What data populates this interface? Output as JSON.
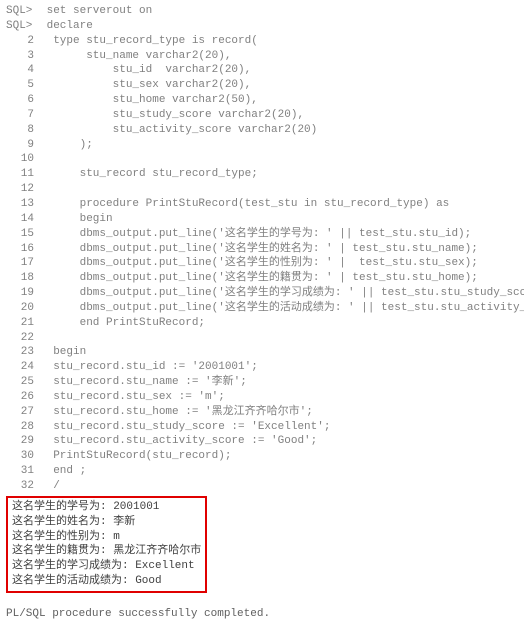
{
  "prompts": {
    "sql": "SQL>",
    "n2": "  2",
    "n3": "  3",
    "n4": "  4",
    "n5": "  5",
    "n6": "  6",
    "n7": "  7",
    "n8": "  8",
    "n9": "  9",
    "n10": " 10",
    "n11": " 11",
    "n12": " 12",
    "n13": " 13",
    "n14": " 14",
    "n15": " 15",
    "n16": " 16",
    "n17": " 17",
    "n18": " 18",
    "n19": " 19",
    "n20": " 20",
    "n21": " 21",
    "n22": " 22",
    "n23": " 23",
    "n24": " 24",
    "n25": " 25",
    "n26": " 26",
    "n27": " 27",
    "n28": " 28",
    "n29": " 29",
    "n30": " 30",
    "n31": " 31",
    "n32": " 32"
  },
  "code": {
    "l1": " set serverout on",
    "l2": " declare",
    "l3": "  type stu_record_type is record(",
    "l4": "       stu_name varchar2(20),",
    "l5": "           stu_id  varchar2(20),",
    "l6": "           stu_sex varchar2(20),",
    "l7": "           stu_home varchar2(50),",
    "l8": "           stu_study_score varchar2(20),",
    "l9": "           stu_activity_score varchar2(20)",
    "l10": "      );",
    "l11": "",
    "l12": "      stu_record stu_record_type;",
    "l13": "",
    "l14": "      procedure PrintStuRecord(test_stu in stu_record_type) as",
    "l15": "      begin",
    "l16": "      dbms_output.put_line('这名学生的学号为: ' || test_stu.stu_id);",
    "l17": "      dbms_output.put_line('这名学生的姓名为: ' | test_stu.stu_name);",
    "l18": "      dbms_output.put_line('这名学生的性别为: ' |  test_stu.stu_sex);",
    "l19": "      dbms_output.put_line('这名学生的籍贯为: ' | test_stu.stu_home);",
    "l20": "      dbms_output.put_line('这名学生的学习成绩为: ' || test_stu.stu_study_score);",
    "l21": "      dbms_output.put_line('这名学生的活动成绩为: ' || test_stu.stu_activity_score);",
    "l22": "      end PrintStuRecord;",
    "l23": "",
    "l24": "  begin",
    "l25": "  stu_record.stu_id := '2001001';",
    "l26": "  stu_record.stu_name := '李新';",
    "l27": "  stu_record.stu_sex := 'm';",
    "l28": "  stu_record.stu_home := '黑龙江齐齐哈尔市';",
    "l29": "  stu_record.stu_study_score := 'Excellent';",
    "l30": "  stu_record.stu_activity_score := 'Good';",
    "l31": "  PrintStuRecord(stu_record);",
    "l32": "  end ;",
    "l33": "  /"
  },
  "output": {
    "o1": "这名学生的学号为: 2001001",
    "o2": "这名学生的姓名为: 李新",
    "o3": "这名学生的性别为: m",
    "o4": "这名学生的籍贯为: 黑龙江齐齐哈尔市",
    "o5": "这名学生的学习成绩为: Excellent",
    "o6": "这名学生的活动成绩为: Good"
  },
  "final_message": "PL/SQL procedure successfully completed."
}
